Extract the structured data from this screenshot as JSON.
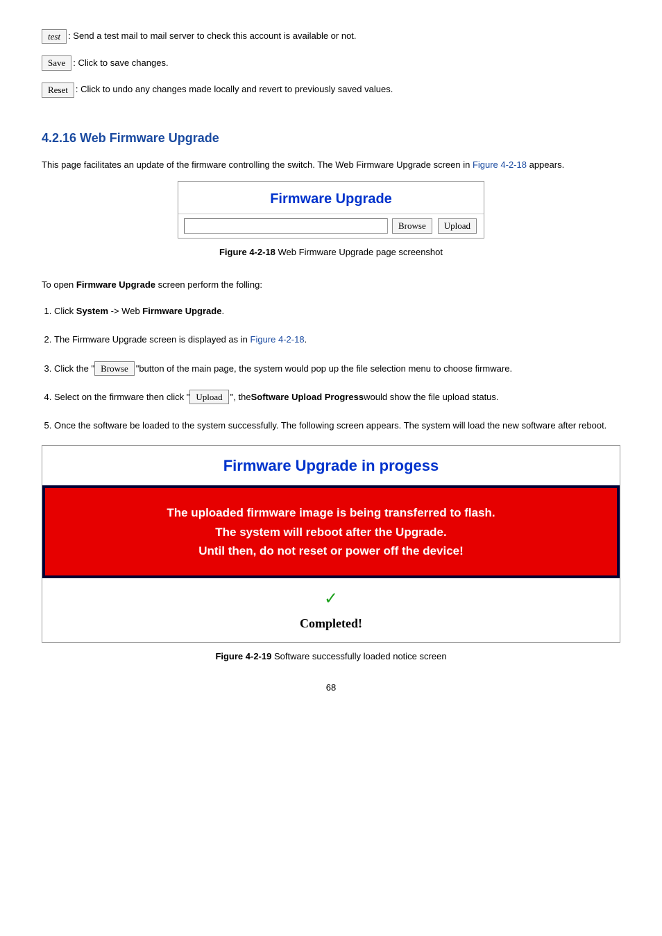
{
  "buttons": {
    "test": "test",
    "save": "Save",
    "reset": "Reset",
    "browse": "Browse",
    "upload": "Upload"
  },
  "descs": {
    "test": ": Send a test mail to mail server to check this account is available or not.",
    "save": ": Click to save changes.",
    "reset": ": Click to undo any changes made locally and revert to previously saved values."
  },
  "section": {
    "heading": "4.2.16 Web Firmware Upgrade",
    "intro_a": "This page facilitates an update of the firmware controlling the switch. The Web Firmware Upgrade screen in ",
    "intro_ref": "Figure 4-2-18",
    "intro_b": " appears."
  },
  "figure1": {
    "title": "Firmware Upgrade",
    "caption_prefix": "Figure 4-2-18 ",
    "caption": "Web Firmware Upgrade page screenshot"
  },
  "open": {
    "prefix": "To open ",
    "bold": "Firmware Upgrade",
    "suffix": " screen perform the folling:"
  },
  "steps": {
    "s1_a": "Click ",
    "s1_b": "System",
    "s1_c": " -> Web ",
    "s1_d": "Firmware Upgrade",
    "s1_e": ".",
    "s2_a": "The Firmware Upgrade screen is displayed as in ",
    "s2_ref": "Figure 4-2-18",
    "s2_b": ".",
    "s3_a": "Click the \"",
    "s3_b": "\"button of the main page, the system would pop up the file selection menu to choose firmware.",
    "s4_a": "Select on the firmware then click \"",
    "s4_b": "\", the ",
    "s4_bold": "Software Upload Progress",
    "s4_c": " would show the file upload status.",
    "s5": "Once the software be loaded to the system successfully. The following screen appears. The system will load the new software after reboot."
  },
  "figure2": {
    "title": "Firmware Upgrade in progess",
    "warn1": "The uploaded firmware image is being transferred to flash.",
    "warn2": "The system will reboot after the Upgrade.",
    "warn3": "Until then, do not reset or power off the device!",
    "completed": "Completed!",
    "caption_prefix": "Figure 4-2-19 ",
    "caption": "Software successfully loaded notice screen"
  },
  "page_number": "68"
}
